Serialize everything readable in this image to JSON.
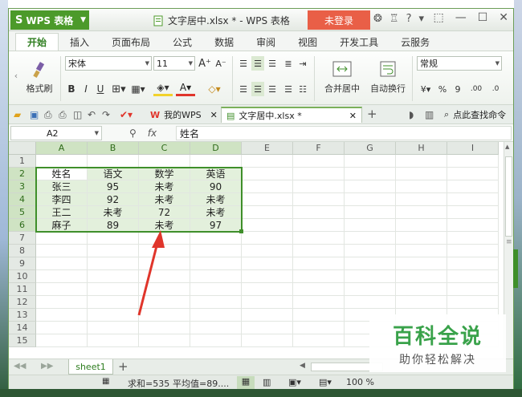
{
  "titlebar": {
    "app_name": "WPS 表格",
    "doc_title": "文字居中.xlsx * - WPS 表格",
    "login_label": "未登录"
  },
  "menu": {
    "tabs": [
      "开始",
      "插入",
      "页面布局",
      "公式",
      "数据",
      "审阅",
      "视图",
      "开发工具",
      "云服务"
    ]
  },
  "ribbon": {
    "format_painter": "格式刷",
    "font_name": "宋体",
    "font_size": "11",
    "merge_center": "合并居中",
    "wrap_text": "自动换行",
    "number_format": "常规",
    "bold": "B",
    "italic": "I",
    "underline": "U",
    "percent": "%",
    "comma": "9",
    "decimal_inc": ".00",
    "decimal_dec": ".0"
  },
  "tabs": {
    "wps_tab": "我的WPS",
    "doc_tab": "文字居中.xlsx *",
    "search_label": "点此查找命令"
  },
  "formula": {
    "namebox": "A2",
    "fx": "fx",
    "value": "姓名"
  },
  "grid": {
    "columns": [
      "A",
      "B",
      "C",
      "D",
      "E",
      "F",
      "G",
      "H",
      "I"
    ],
    "rows": [
      "1",
      "2",
      "3",
      "4",
      "5",
      "6",
      "7",
      "8",
      "9",
      "10",
      "11",
      "12",
      "13",
      "14",
      "15"
    ],
    "data": [
      [
        "姓名",
        "语文",
        "数学",
        "英语"
      ],
      [
        "张三",
        "95",
        "未考",
        "90"
      ],
      [
        "李四",
        "92",
        "未考",
        "未考"
      ],
      [
        "王二",
        "未考",
        "72",
        "未考"
      ],
      [
        "麻子",
        "89",
        "未考",
        "97"
      ]
    ]
  },
  "sheets": {
    "active": "sheet1",
    "add": "+"
  },
  "status": {
    "sum": "求和=535",
    "avg": "平均值=89....",
    "zoom": "100 %"
  },
  "watermark": {
    "title": "百科全说",
    "subtitle": "助你轻松解决"
  },
  "colors": {
    "accent": "#4c9a2a",
    "selection": "#3f8f2a",
    "login": "#e95f47",
    "arrow": "#e0352b"
  }
}
